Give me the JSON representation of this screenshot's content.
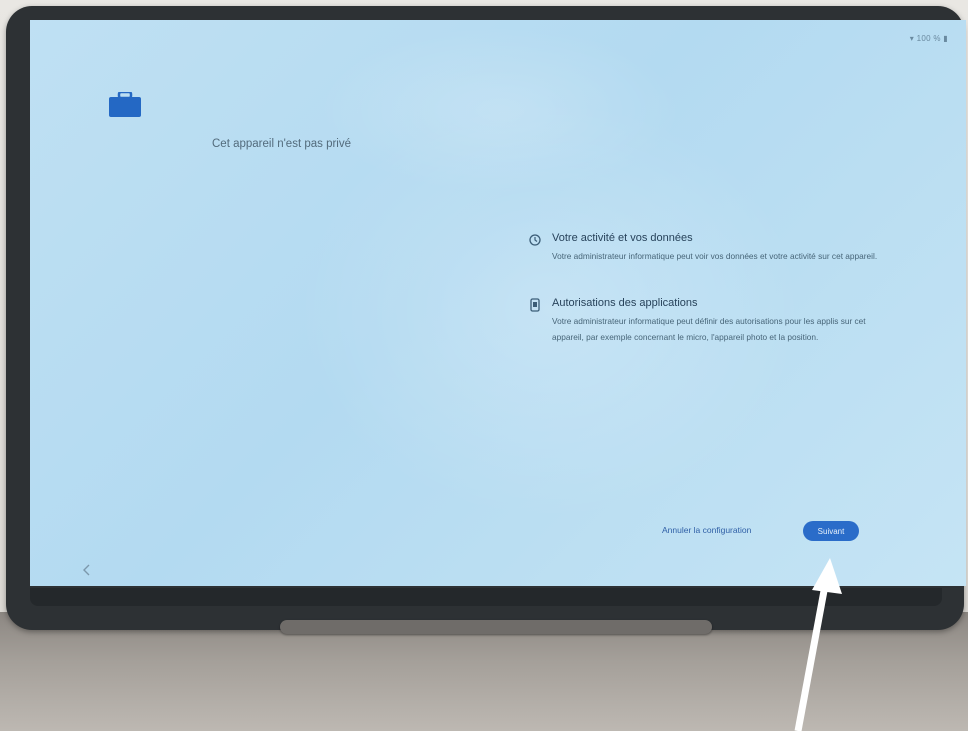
{
  "status_bar": {
    "text": "100 %"
  },
  "header": {
    "icon": "briefcase-icon",
    "title": "Cet appareil n'est pas privé"
  },
  "info": [
    {
      "icon": "history-icon",
      "title": "Votre activité et vos données",
      "description": "Votre administrateur informatique peut voir vos données et votre activité sur cet appareil."
    },
    {
      "icon": "phone-icon",
      "title": "Autorisations des applications",
      "description": "Votre administrateur informatique peut définir des autorisations pour les applis sur cet appareil, par exemple concernant le micro, l'appareil photo et la position."
    }
  ],
  "footer": {
    "cancel_label": "Annuler la configuration",
    "next_label": "Suivant"
  },
  "nav": {
    "back_icon": "back-chevron-icon"
  },
  "colors": {
    "accent": "#2a6cc9",
    "screen_background": "#b8dcf2",
    "arrow": "#ffffff"
  }
}
